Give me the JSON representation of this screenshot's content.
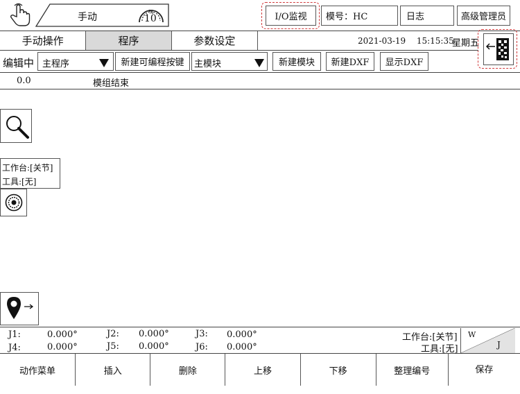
{
  "header": {
    "hand_icon": "hand-pointer-icon",
    "mode_label": "手动",
    "speed": {
      "percent_symbol": "%",
      "value": "10"
    },
    "io_monitor_label": "I/O监视",
    "model_label": "模号：HC",
    "log_label": "日志",
    "user_label": "高级管理员"
  },
  "tabs": [
    {
      "label": "手动操作"
    },
    {
      "label": "程序"
    },
    {
      "label": "参数设定"
    }
  ],
  "status": {
    "date": "2021-03-19",
    "time": "15:15:35",
    "weekday": "星期五"
  },
  "toolbar": {
    "editing_label": "编辑中",
    "program_select": "主程序",
    "new_key_label": "新建可编程按键",
    "module_select": "主模块",
    "new_module_label": "新建模块",
    "new_dxf_label": "新建DXF",
    "show_dxf_label": "显示DXF"
  },
  "program_list": [
    {
      "line": "0.0",
      "text": "模组结束"
    }
  ],
  "side_panel": {
    "workbench_label": "工作台:",
    "workbench_value": "[关节]",
    "tool_label": "工具:",
    "tool_value": "[无]"
  },
  "coords": {
    "j1_label": "J1:",
    "j1_value": "0.000°",
    "j2_label": "J2:",
    "j2_value": "0.000°",
    "j3_label": "J3:",
    "j3_value": "0.000°",
    "j4_label": "J4:",
    "j4_value": "0.000°",
    "j5_label": "J5:",
    "j5_value": "0.000°",
    "j6_label": "J6:",
    "j6_value": "0.000°",
    "workbench_label": "工作台:",
    "workbench_value": "[关节]",
    "tool_label": "工具:",
    "tool_value": "[无]",
    "frame_w": "W",
    "frame_j": "J"
  },
  "bottom_bar": [
    {
      "label": "动作菜单"
    },
    {
      "label": "插入"
    },
    {
      "label": "删除"
    },
    {
      "label": "上移"
    },
    {
      "label": "下移"
    },
    {
      "label": "整理编号"
    },
    {
      "label": "保存"
    }
  ],
  "colors": {
    "highlight": "#d0393a",
    "active_tab": "#d9d9d9",
    "line": "#444444"
  }
}
